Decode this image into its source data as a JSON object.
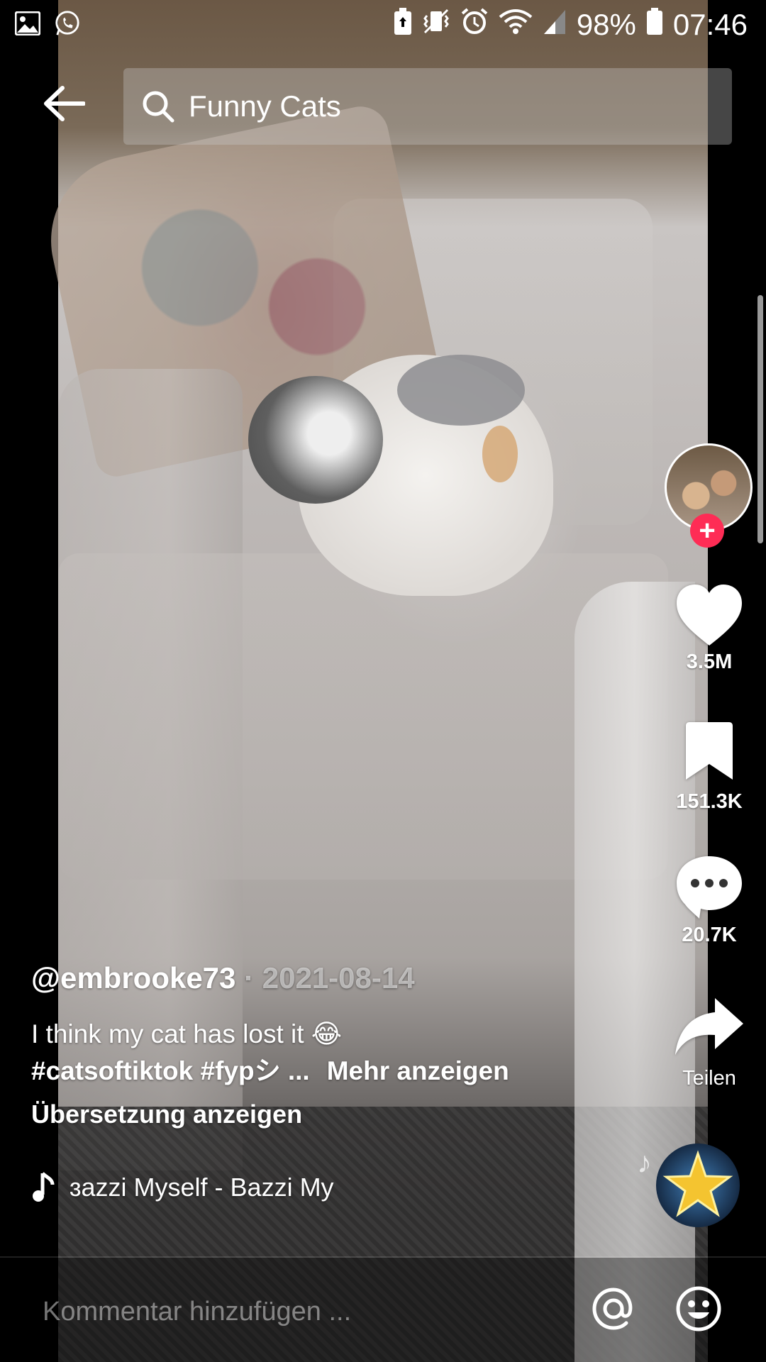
{
  "status_bar": {
    "left_icons": [
      "gallery-icon",
      "whatsapp-icon"
    ],
    "right_icons": [
      "battery-saver-icon",
      "vibrate-icon",
      "alarm-icon",
      "wifi-icon",
      "signal-icon",
      "battery-icon"
    ],
    "battery": "98%",
    "time": "07:46"
  },
  "search": {
    "query": "Funny Cats"
  },
  "video": {
    "username": "@embrooke73",
    "separator": " · ",
    "date": "2021-08-14",
    "caption": "I think my cat has lost it 😂",
    "hashtags": "#catsoftiktok  #fypシ ...",
    "more_label": "Mehr anzeigen",
    "translate_label": "Übersetzung anzeigen",
    "music": "ɜazzi    Myself - Bazzi    My"
  },
  "actions": {
    "likes": "3.5M",
    "saves": "151.3K",
    "comments": "20.7K",
    "share_label": "Teilen"
  },
  "comment_bar": {
    "placeholder": "Kommentar hinzufügen ..."
  },
  "colors": {
    "accent": "#fe2c55",
    "background": "#000000"
  }
}
